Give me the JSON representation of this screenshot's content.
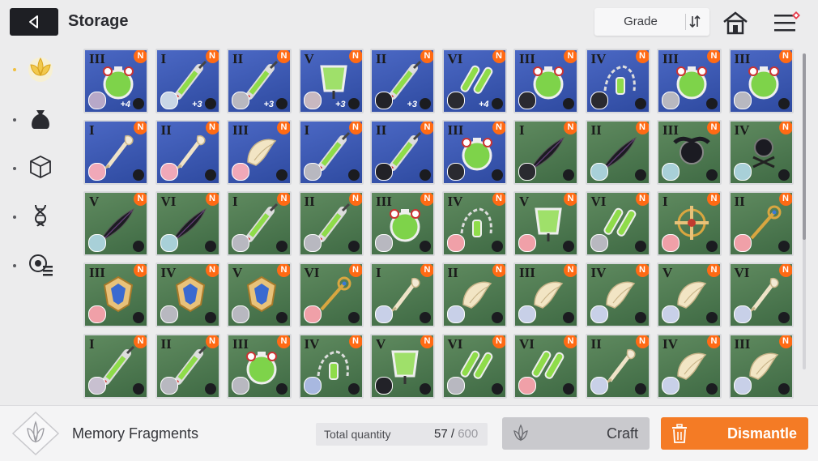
{
  "header": {
    "title": "Storage",
    "grade_label": "Grade"
  },
  "sidebar": {
    "items": [
      {
        "name": "memory-fragment-tab",
        "icon": "lotus-icon",
        "active": true
      },
      {
        "name": "bag-tab",
        "icon": "bag-icon",
        "active": false
      },
      {
        "name": "cube-tab",
        "icon": "cube-icon",
        "active": false
      },
      {
        "name": "dna-tab",
        "icon": "dna-icon",
        "active": false
      },
      {
        "name": "gear-list-tab",
        "icon": "gear-list-icon",
        "active": false
      }
    ]
  },
  "grid": {
    "rows": [
      [
        {
          "numeral": "III",
          "color": "blue",
          "art": "flask",
          "level": "+4",
          "avatar": "#b7a8c8"
        },
        {
          "numeral": "I",
          "color": "blue",
          "art": "syringe",
          "level": "+3",
          "avatar": "#c9d6e6"
        },
        {
          "numeral": "II",
          "color": "blue",
          "art": "syringe",
          "level": "+3",
          "avatar": "#b8b8c0"
        },
        {
          "numeral": "V",
          "color": "blue",
          "art": "beaker",
          "level": "+3",
          "avatar": "#c8b8c0"
        },
        {
          "numeral": "II",
          "color": "blue",
          "art": "syringe",
          "level": "+3",
          "avatar": "#222228"
        },
        {
          "numeral": "VI",
          "color": "blue",
          "art": "vials",
          "level": "+4",
          "avatar": "#2a2a30"
        },
        {
          "numeral": "III",
          "color": "blue",
          "art": "flask",
          "level": "",
          "avatar": "#2a2a30"
        },
        {
          "numeral": "IV",
          "color": "blue",
          "art": "chain",
          "level": "",
          "avatar": "#2a2a30"
        },
        {
          "numeral": "III",
          "color": "blue",
          "art": "flask",
          "level": "",
          "avatar": "#b8b8c0"
        },
        {
          "numeral": "III",
          "color": "blue",
          "art": "flask",
          "level": "",
          "avatar": "#b8b8c0"
        }
      ],
      [
        {
          "numeral": "I",
          "color": "blue",
          "art": "key",
          "level": "",
          "avatar": "#f0a8b8"
        },
        {
          "numeral": "II",
          "color": "blue",
          "art": "key",
          "level": "",
          "avatar": "#f0a8b8"
        },
        {
          "numeral": "III",
          "color": "blue",
          "art": "shell",
          "level": "",
          "avatar": "#f0a8b8"
        },
        {
          "numeral": "I",
          "color": "blue",
          "art": "syringe",
          "level": "",
          "avatar": "#b8b8c0"
        },
        {
          "numeral": "II",
          "color": "blue",
          "art": "syringe",
          "level": "",
          "avatar": "#222228"
        },
        {
          "numeral": "III",
          "color": "blue",
          "art": "flask",
          "level": "",
          "avatar": "#2a2a30"
        },
        {
          "numeral": "I",
          "color": "green",
          "art": "dark-feather",
          "level": "",
          "avatar": "#2a2a30"
        },
        {
          "numeral": "II",
          "color": "green",
          "art": "dark-feather",
          "level": "",
          "avatar": "#a8d0d8"
        },
        {
          "numeral": "III",
          "color": "green",
          "art": "dark-orb",
          "level": "",
          "avatar": "#a8d0d8"
        },
        {
          "numeral": "IV",
          "color": "green",
          "art": "dark-chain",
          "level": "",
          "avatar": "#a8d0d8"
        }
      ],
      [
        {
          "numeral": "V",
          "color": "green",
          "art": "dark-feather",
          "level": "",
          "avatar": "#a8d0d8"
        },
        {
          "numeral": "VI",
          "color": "green",
          "art": "dark-feather",
          "level": "",
          "avatar": "#a8d0d8"
        },
        {
          "numeral": "I",
          "color": "green",
          "art": "syringe",
          "level": "",
          "avatar": "#b8b8c0"
        },
        {
          "numeral": "II",
          "color": "green",
          "art": "syringe",
          "level": "",
          "avatar": "#b8b8c0"
        },
        {
          "numeral": "III",
          "color": "green",
          "art": "flask",
          "level": "",
          "avatar": "#b8b8c0"
        },
        {
          "numeral": "IV",
          "color": "green",
          "art": "chain",
          "level": "",
          "avatar": "#f0a0a8"
        },
        {
          "numeral": "V",
          "color": "green",
          "art": "beaker",
          "level": "",
          "avatar": "#f0a0a8"
        },
        {
          "numeral": "VI",
          "color": "green",
          "art": "vials",
          "level": "",
          "avatar": "#b8b8c0"
        },
        {
          "numeral": "I",
          "color": "green",
          "art": "gold-cross",
          "level": "",
          "avatar": "#f0a0a8"
        },
        {
          "numeral": "II",
          "color": "green",
          "art": "gold-key",
          "level": "",
          "avatar": "#f0a0a8"
        }
      ],
      [
        {
          "numeral": "III",
          "color": "green",
          "art": "gold-crest",
          "level": "",
          "avatar": "#f0a0a8"
        },
        {
          "numeral": "IV",
          "color": "green",
          "art": "gold-crest",
          "level": "",
          "avatar": "#b8b8c0"
        },
        {
          "numeral": "V",
          "color": "green",
          "art": "gold-crest",
          "level": "",
          "avatar": "#b8b8c0"
        },
        {
          "numeral": "VI",
          "color": "green",
          "art": "gold-key",
          "level": "",
          "avatar": "#f0a0a8"
        },
        {
          "numeral": "I",
          "color": "green",
          "art": "key",
          "level": "",
          "avatar": "#c8d0e8"
        },
        {
          "numeral": "II",
          "color": "green",
          "art": "shell",
          "level": "",
          "avatar": "#c8d0e8"
        },
        {
          "numeral": "III",
          "color": "green",
          "art": "shell",
          "level": "",
          "avatar": "#c8d0e8"
        },
        {
          "numeral": "IV",
          "color": "green",
          "art": "shell",
          "level": "",
          "avatar": "#c8d0e8"
        },
        {
          "numeral": "V",
          "color": "green",
          "art": "shell",
          "level": "",
          "avatar": "#c8d0e8"
        },
        {
          "numeral": "VI",
          "color": "green",
          "art": "key",
          "level": "",
          "avatar": "#c8d0e8"
        }
      ],
      [
        {
          "numeral": "I",
          "color": "green",
          "art": "syringe",
          "level": "",
          "avatar": "#c8c0d0"
        },
        {
          "numeral": "II",
          "color": "green",
          "art": "syringe",
          "level": "",
          "avatar": "#b8b8c0"
        },
        {
          "numeral": "III",
          "color": "green",
          "art": "flask",
          "level": "",
          "avatar": "#b8b8c0"
        },
        {
          "numeral": "IV",
          "color": "green",
          "art": "chain",
          "level": "",
          "avatar": "#a8b8e0"
        },
        {
          "numeral": "V",
          "color": "green",
          "art": "beaker",
          "level": "",
          "avatar": "#222228"
        },
        {
          "numeral": "VI",
          "color": "green",
          "art": "vials",
          "level": "",
          "avatar": "#b8b8c0"
        },
        {
          "numeral": "VI",
          "color": "green",
          "art": "vials",
          "level": "",
          "avatar": "#f0a0a8"
        },
        {
          "numeral": "II",
          "color": "green",
          "art": "key",
          "level": "",
          "avatar": "#c8d0e8"
        },
        {
          "numeral": "IV",
          "color": "green",
          "art": "shell",
          "level": "",
          "avatar": "#c8d0e8"
        },
        {
          "numeral": "III",
          "color": "green",
          "art": "shell",
          "level": "",
          "avatar": "#c8d0e8"
        }
      ]
    ],
    "new_badge": "N"
  },
  "footer": {
    "category": "Memory Fragments",
    "total_quantity_label": "Total quantity",
    "quantity": "57",
    "quantity_separator": " / ",
    "capacity": "600",
    "craft_label": "Craft",
    "dismantle_label": "Dismantle"
  },
  "colors": {
    "accent_orange": "#f47b25",
    "card_blue": "#3a56b0",
    "card_green": "#4f7a52",
    "badge": "#ff6a14"
  }
}
